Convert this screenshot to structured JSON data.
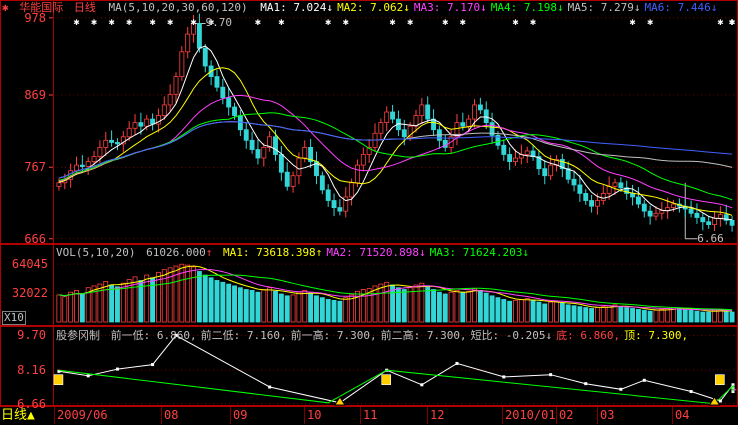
{
  "colors": {
    "bg": "#000000",
    "frame": "#b00000",
    "grid": "#700000",
    "up": "#ff4040",
    "down": "#33d6d6",
    "axis": "#ff4040",
    "text": "#c0c0c0",
    "ma1": "#ffffff",
    "ma2": "#ffff00",
    "ma3": "#ff40ff",
    "ma4": "#00ff00",
    "ma5": "#c0c0c0",
    "ma6": "#4060ff",
    "vol_up": "#ff4040",
    "vol_down": "#33d6d6",
    "zigzag": "#ffffff",
    "trend": "#00ff00"
  },
  "header": {
    "stock_name": "华能国际",
    "period": "日线",
    "ma_def": "MA(5,10,20,30,60,120)",
    "ma_items": [
      {
        "label": "MA1:",
        "value": "7.024",
        "arrow": "↓",
        "color": "#ffffff"
      },
      {
        "label": "MA2:",
        "value": "7.062",
        "arrow": "↓",
        "color": "#ffff00"
      },
      {
        "label": "MA3:",
        "value": "7.170",
        "arrow": "↓",
        "color": "#ff40ff"
      },
      {
        "label": "MA4:",
        "value": "7.198",
        "arrow": "↓",
        "color": "#00ff00"
      },
      {
        "label": "MA5:",
        "value": "7.279",
        "arrow": "↓",
        "color": "#c0c0c0"
      },
      {
        "label": "MA6:",
        "value": "7.446",
        "arrow": "↓",
        "color": "#4060ff"
      }
    ]
  },
  "price_axis": {
    "ticks": [
      "978",
      "869",
      "767",
      "666"
    ],
    "tick_values": [
      9.78,
      8.69,
      7.67,
      6.66
    ],
    "high_label": "9.70",
    "low_label": "6.66"
  },
  "volume_panel": {
    "title": "VOL(5,10,20)",
    "vol_value": "61026.000",
    "vol_arrow": "↑",
    "items": [
      {
        "label": "MA1:",
        "value": "73618.398",
        "arrow": "↑",
        "color": "#ffff00"
      },
      {
        "label": "MA2:",
        "value": "71520.898",
        "arrow": "↓",
        "color": "#ff40ff"
      },
      {
        "label": "MA3:",
        "value": "71624.203",
        "arrow": "↓",
        "color": "#00ff00"
      }
    ],
    "ticks": [
      "64045",
      "32022"
    ],
    "tick_values": [
      64045,
      32022
    ],
    "unit": "X10"
  },
  "indicator_panel": {
    "title": "股参冈制",
    "items": [
      {
        "text": "前一低: 6.860,",
        "color": "#c0c0c0"
      },
      {
        "text": "前二低: 7.160,",
        "color": "#c0c0c0"
      },
      {
        "text": "前一高: 7.300,",
        "color": "#c0c0c0"
      },
      {
        "text": "前二高: 7.300,",
        "color": "#c0c0c0"
      },
      {
        "text": "短比: -0.205",
        "color": "#c0c0c0",
        "arrow": "↓"
      },
      {
        "text": "底: 6.860,",
        "color": "#ff4040"
      },
      {
        "text": "顶: 7.300,",
        "color": "#ffff00"
      }
    ],
    "ticks": [
      "9.70",
      "8.16",
      "6.66"
    ],
    "tick_values": [
      9.7,
      8.16,
      6.66
    ]
  },
  "bottom_bar": {
    "period_button": "日线",
    "dates": [
      "2009/06",
      "08",
      "09",
      "10",
      "11",
      "12",
      "2010/01",
      "02",
      "03",
      "04"
    ]
  },
  "chart_data": [
    {
      "type": "candlestick",
      "name_ref": "header.stock_name",
      "ylim": [
        6.6,
        9.82
      ],
      "close": [
        7.45,
        7.5,
        7.62,
        7.7,
        7.68,
        7.75,
        7.82,
        7.95,
        8.05,
        8.02,
        8.0,
        8.1,
        8.22,
        8.3,
        8.25,
        8.35,
        8.28,
        8.4,
        8.55,
        8.7,
        8.95,
        9.3,
        9.55,
        9.7,
        9.35,
        9.1,
        8.95,
        8.8,
        8.65,
        8.52,
        8.4,
        8.2,
        8.05,
        7.92,
        7.8,
        7.95,
        8.1,
        7.85,
        7.6,
        7.4,
        7.55,
        7.8,
        7.95,
        7.75,
        7.55,
        7.35,
        7.2,
        7.1,
        7.05,
        7.25,
        7.45,
        7.7,
        7.85,
        7.95,
        8.15,
        8.3,
        8.45,
        8.35,
        8.2,
        8.1,
        8.25,
        8.4,
        8.55,
        8.35,
        8.2,
        8.05,
        7.95,
        8.1,
        8.3,
        8.25,
        8.35,
        8.55,
        8.48,
        8.3,
        8.12,
        7.98,
        7.85,
        7.75,
        7.8,
        7.85,
        7.9,
        7.82,
        7.65,
        7.55,
        7.7,
        7.78,
        7.65,
        7.5,
        7.42,
        7.3,
        7.2,
        7.12,
        7.2,
        7.3,
        7.4,
        7.45,
        7.38,
        7.3,
        7.25,
        7.15,
        7.05,
        6.98,
        7.02,
        7.06,
        7.1,
        7.15,
        7.12,
        7.08,
        7.02,
        6.96,
        6.9,
        6.86,
        6.95,
        7.0,
        6.92,
        6.85
      ],
      "open": [
        7.4,
        7.45,
        7.5,
        7.62,
        7.7,
        7.68,
        7.75,
        7.82,
        7.95,
        8.05,
        8.02,
        8.0,
        8.1,
        8.22,
        8.3,
        8.25,
        8.35,
        8.28,
        8.4,
        8.55,
        8.7,
        8.95,
        9.3,
        9.55,
        9.7,
        9.35,
        9.1,
        8.95,
        8.8,
        8.65,
        8.52,
        8.4,
        8.2,
        8.05,
        7.92,
        7.8,
        7.95,
        8.1,
        7.85,
        7.6,
        7.4,
        7.55,
        7.8,
        7.95,
        7.75,
        7.55,
        7.35,
        7.2,
        7.1,
        7.05,
        7.25,
        7.45,
        7.7,
        7.85,
        7.95,
        8.15,
        8.3,
        8.45,
        8.35,
        8.2,
        8.1,
        8.25,
        8.4,
        8.55,
        8.35,
        8.2,
        8.05,
        7.95,
        8.1,
        8.3,
        8.25,
        8.35,
        8.55,
        8.48,
        8.3,
        8.12,
        7.98,
        7.85,
        7.75,
        7.8,
        7.85,
        7.9,
        7.82,
        7.65,
        7.55,
        7.7,
        7.78,
        7.65,
        7.5,
        7.42,
        7.3,
        7.2,
        7.12,
        7.2,
        7.3,
        7.4,
        7.45,
        7.38,
        7.3,
        7.25,
        7.15,
        7.05,
        6.98,
        7.02,
        7.06,
        7.1,
        7.15,
        7.12,
        7.08,
        7.02,
        6.96,
        6.9,
        6.86,
        6.95,
        7.0,
        6.92
      ],
      "ma_periods": [
        5,
        10,
        20,
        30,
        60,
        120
      ]
    },
    {
      "type": "bar",
      "name_ref": "volume_panel.title",
      "ylim": [
        0,
        72000
      ],
      "values": [
        30000,
        28000,
        33000,
        35000,
        31000,
        38000,
        40000,
        42000,
        45000,
        41000,
        39000,
        43000,
        47000,
        50000,
        46000,
        52000,
        49000,
        55000,
        58000,
        60000,
        62000,
        64000,
        63000,
        61000,
        56000,
        52000,
        49000,
        46000,
        44000,
        42000,
        40000,
        38000,
        36000,
        35000,
        33000,
        36000,
        38000,
        34000,
        31000,
        29000,
        30000,
        33000,
        35000,
        32000,
        29000,
        27000,
        25000,
        24000,
        23000,
        27000,
        30000,
        34000,
        36000,
        37000,
        40000,
        42000,
        44000,
        41000,
        38000,
        36000,
        38000,
        41000,
        43000,
        39000,
        36000,
        33000,
        31000,
        33000,
        35000,
        33000,
        34000,
        37000,
        35000,
        32000,
        29000,
        27000,
        25000,
        23000,
        24000,
        25000,
        26000,
        24000,
        22000,
        20000,
        22000,
        23000,
        21000,
        19000,
        18000,
        17000,
        16000,
        15000,
        16000,
        17000,
        18000,
        19000,
        17000,
        16000,
        15000,
        14000,
        13000,
        12000,
        13000,
        14000,
        15000,
        16000,
        15000,
        14000,
        13000,
        12000,
        11000,
        11000,
        13000,
        14000,
        12000,
        11000
      ]
    },
    {
      "type": "line",
      "name_ref": "indicator_panel.title",
      "ylim": [
        6.6,
        9.85
      ],
      "zigzag": [
        [
          0,
          8.1
        ],
        [
          5,
          7.9
        ],
        [
          10,
          8.2
        ],
        [
          16,
          8.4
        ],
        [
          20,
          9.7
        ],
        [
          36,
          7.4
        ],
        [
          48,
          6.7
        ],
        [
          56,
          8.15
        ],
        [
          62,
          7.5
        ],
        [
          68,
          8.45
        ],
        [
          76,
          7.85
        ],
        [
          84,
          7.95
        ],
        [
          90,
          7.55
        ],
        [
          96,
          7.3
        ],
        [
          100,
          7.7
        ],
        [
          108,
          7.2
        ],
        [
          113,
          6.78
        ],
        [
          118,
          7.5
        ],
        [
          124,
          7.35
        ],
        [
          129,
          7.2
        ]
      ],
      "trend": [
        [
          0,
          8.15
        ],
        [
          46,
          6.7
        ],
        [
          56,
          8.15
        ],
        [
          112,
          6.66
        ],
        [
          118,
          7.45
        ],
        [
          124,
          7.2
        ],
        [
          130,
          7.28
        ]
      ]
    }
  ]
}
